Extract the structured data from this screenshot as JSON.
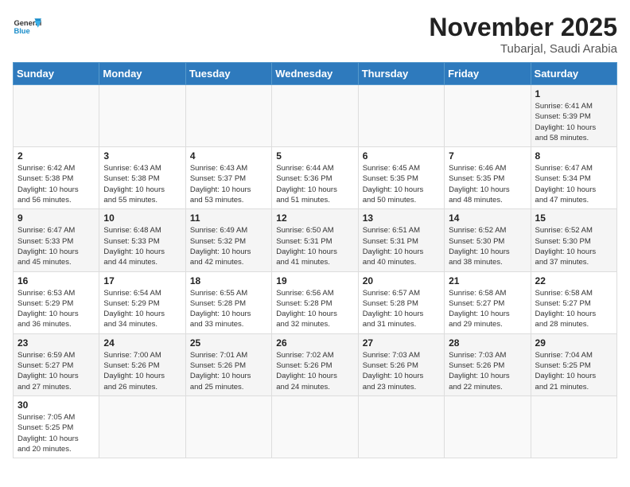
{
  "header": {
    "logo_general": "General",
    "logo_blue": "Blue",
    "month_year": "November 2025",
    "location": "Tubarjal, Saudi Arabia"
  },
  "days_of_week": [
    "Sunday",
    "Monday",
    "Tuesday",
    "Wednesday",
    "Thursday",
    "Friday",
    "Saturday"
  ],
  "weeks": [
    [
      {
        "day": "",
        "info": ""
      },
      {
        "day": "",
        "info": ""
      },
      {
        "day": "",
        "info": ""
      },
      {
        "day": "",
        "info": ""
      },
      {
        "day": "",
        "info": ""
      },
      {
        "day": "",
        "info": ""
      },
      {
        "day": "1",
        "info": "Sunrise: 6:41 AM\nSunset: 5:39 PM\nDaylight: 10 hours\nand 58 minutes."
      }
    ],
    [
      {
        "day": "2",
        "info": "Sunrise: 6:42 AM\nSunset: 5:38 PM\nDaylight: 10 hours\nand 56 minutes."
      },
      {
        "day": "3",
        "info": "Sunrise: 6:43 AM\nSunset: 5:38 PM\nDaylight: 10 hours\nand 55 minutes."
      },
      {
        "day": "4",
        "info": "Sunrise: 6:43 AM\nSunset: 5:37 PM\nDaylight: 10 hours\nand 53 minutes."
      },
      {
        "day": "5",
        "info": "Sunrise: 6:44 AM\nSunset: 5:36 PM\nDaylight: 10 hours\nand 51 minutes."
      },
      {
        "day": "6",
        "info": "Sunrise: 6:45 AM\nSunset: 5:35 PM\nDaylight: 10 hours\nand 50 minutes."
      },
      {
        "day": "7",
        "info": "Sunrise: 6:46 AM\nSunset: 5:35 PM\nDaylight: 10 hours\nand 48 minutes."
      },
      {
        "day": "8",
        "info": "Sunrise: 6:47 AM\nSunset: 5:34 PM\nDaylight: 10 hours\nand 47 minutes."
      }
    ],
    [
      {
        "day": "9",
        "info": "Sunrise: 6:47 AM\nSunset: 5:33 PM\nDaylight: 10 hours\nand 45 minutes."
      },
      {
        "day": "10",
        "info": "Sunrise: 6:48 AM\nSunset: 5:33 PM\nDaylight: 10 hours\nand 44 minutes."
      },
      {
        "day": "11",
        "info": "Sunrise: 6:49 AM\nSunset: 5:32 PM\nDaylight: 10 hours\nand 42 minutes."
      },
      {
        "day": "12",
        "info": "Sunrise: 6:50 AM\nSunset: 5:31 PM\nDaylight: 10 hours\nand 41 minutes."
      },
      {
        "day": "13",
        "info": "Sunrise: 6:51 AM\nSunset: 5:31 PM\nDaylight: 10 hours\nand 40 minutes."
      },
      {
        "day": "14",
        "info": "Sunrise: 6:52 AM\nSunset: 5:30 PM\nDaylight: 10 hours\nand 38 minutes."
      },
      {
        "day": "15",
        "info": "Sunrise: 6:52 AM\nSunset: 5:30 PM\nDaylight: 10 hours\nand 37 minutes."
      }
    ],
    [
      {
        "day": "16",
        "info": "Sunrise: 6:53 AM\nSunset: 5:29 PM\nDaylight: 10 hours\nand 36 minutes."
      },
      {
        "day": "17",
        "info": "Sunrise: 6:54 AM\nSunset: 5:29 PM\nDaylight: 10 hours\nand 34 minutes."
      },
      {
        "day": "18",
        "info": "Sunrise: 6:55 AM\nSunset: 5:28 PM\nDaylight: 10 hours\nand 33 minutes."
      },
      {
        "day": "19",
        "info": "Sunrise: 6:56 AM\nSunset: 5:28 PM\nDaylight: 10 hours\nand 32 minutes."
      },
      {
        "day": "20",
        "info": "Sunrise: 6:57 AM\nSunset: 5:28 PM\nDaylight: 10 hours\nand 31 minutes."
      },
      {
        "day": "21",
        "info": "Sunrise: 6:58 AM\nSunset: 5:27 PM\nDaylight: 10 hours\nand 29 minutes."
      },
      {
        "day": "22",
        "info": "Sunrise: 6:58 AM\nSunset: 5:27 PM\nDaylight: 10 hours\nand 28 minutes."
      }
    ],
    [
      {
        "day": "23",
        "info": "Sunrise: 6:59 AM\nSunset: 5:27 PM\nDaylight: 10 hours\nand 27 minutes."
      },
      {
        "day": "24",
        "info": "Sunrise: 7:00 AM\nSunset: 5:26 PM\nDaylight: 10 hours\nand 26 minutes."
      },
      {
        "day": "25",
        "info": "Sunrise: 7:01 AM\nSunset: 5:26 PM\nDaylight: 10 hours\nand 25 minutes."
      },
      {
        "day": "26",
        "info": "Sunrise: 7:02 AM\nSunset: 5:26 PM\nDaylight: 10 hours\nand 24 minutes."
      },
      {
        "day": "27",
        "info": "Sunrise: 7:03 AM\nSunset: 5:26 PM\nDaylight: 10 hours\nand 23 minutes."
      },
      {
        "day": "28",
        "info": "Sunrise: 7:03 AM\nSunset: 5:26 PM\nDaylight: 10 hours\nand 22 minutes."
      },
      {
        "day": "29",
        "info": "Sunrise: 7:04 AM\nSunset: 5:25 PM\nDaylight: 10 hours\nand 21 minutes."
      }
    ],
    [
      {
        "day": "30",
        "info": "Sunrise: 7:05 AM\nSunset: 5:25 PM\nDaylight: 10 hours\nand 20 minutes."
      },
      {
        "day": "",
        "info": ""
      },
      {
        "day": "",
        "info": ""
      },
      {
        "day": "",
        "info": ""
      },
      {
        "day": "",
        "info": ""
      },
      {
        "day": "",
        "info": ""
      },
      {
        "day": "",
        "info": ""
      }
    ]
  ]
}
